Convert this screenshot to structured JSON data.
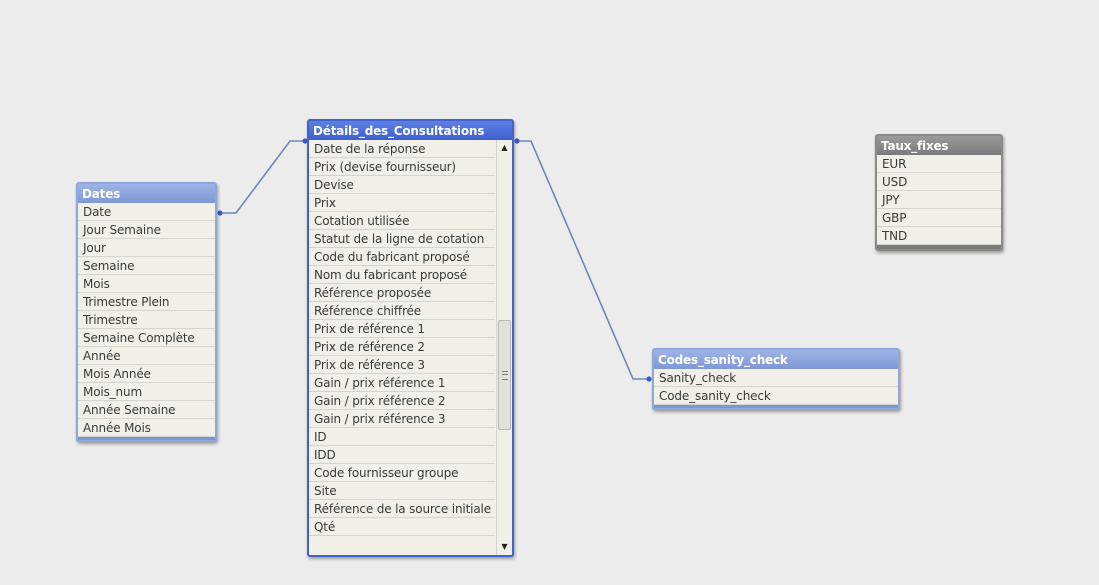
{
  "tables": {
    "dates": {
      "title": "Dates",
      "fields": [
        "Date",
        "Jour Semaine",
        "Jour",
        "Semaine",
        "Mois",
        "Trimestre Plein",
        "Trimestre",
        "Semaine Complète",
        "Année",
        "Mois Année",
        "Mois_num",
        "Année Semaine",
        "Année Mois"
      ]
    },
    "details": {
      "title": "Détails_des_Consultations",
      "fields": [
        "Date de la réponse",
        "Prix (devise fournisseur)",
        "Devise",
        "Prix",
        "Cotation utilisée",
        "Statut de la ligne de cotation",
        "Code du fabricant proposé",
        "Nom du fabricant proposé",
        "Référence proposée",
        "Référence chiffrée",
        "Prix de référence 1",
        "Prix de référence 2",
        "Prix de référence 3",
        "Gain / prix référence 1",
        "Gain / prix référence 2",
        "Gain / prix référence 3",
        "ID",
        "IDD",
        "Code fournisseur groupe",
        "Site",
        "Référence de la source initiale",
        "Qté"
      ]
    },
    "codes": {
      "title": "Codes_sanity_check",
      "fields": [
        "Sanity_check",
        "Code_sanity_check"
      ]
    },
    "taux": {
      "title": "Taux_fixes",
      "fields": [
        "EUR",
        "USD",
        "JPY",
        "GBP",
        "TND"
      ]
    }
  },
  "scrollbar": {
    "up_arrow_icon": "triangle-up",
    "down_arrow_icon": "triangle-down"
  },
  "colors": {
    "selected_table": "#3a5dcb",
    "linked_table": "#7b97d8",
    "unlinked_table": "#7a7a7a",
    "link_line": "#6f86b8"
  }
}
